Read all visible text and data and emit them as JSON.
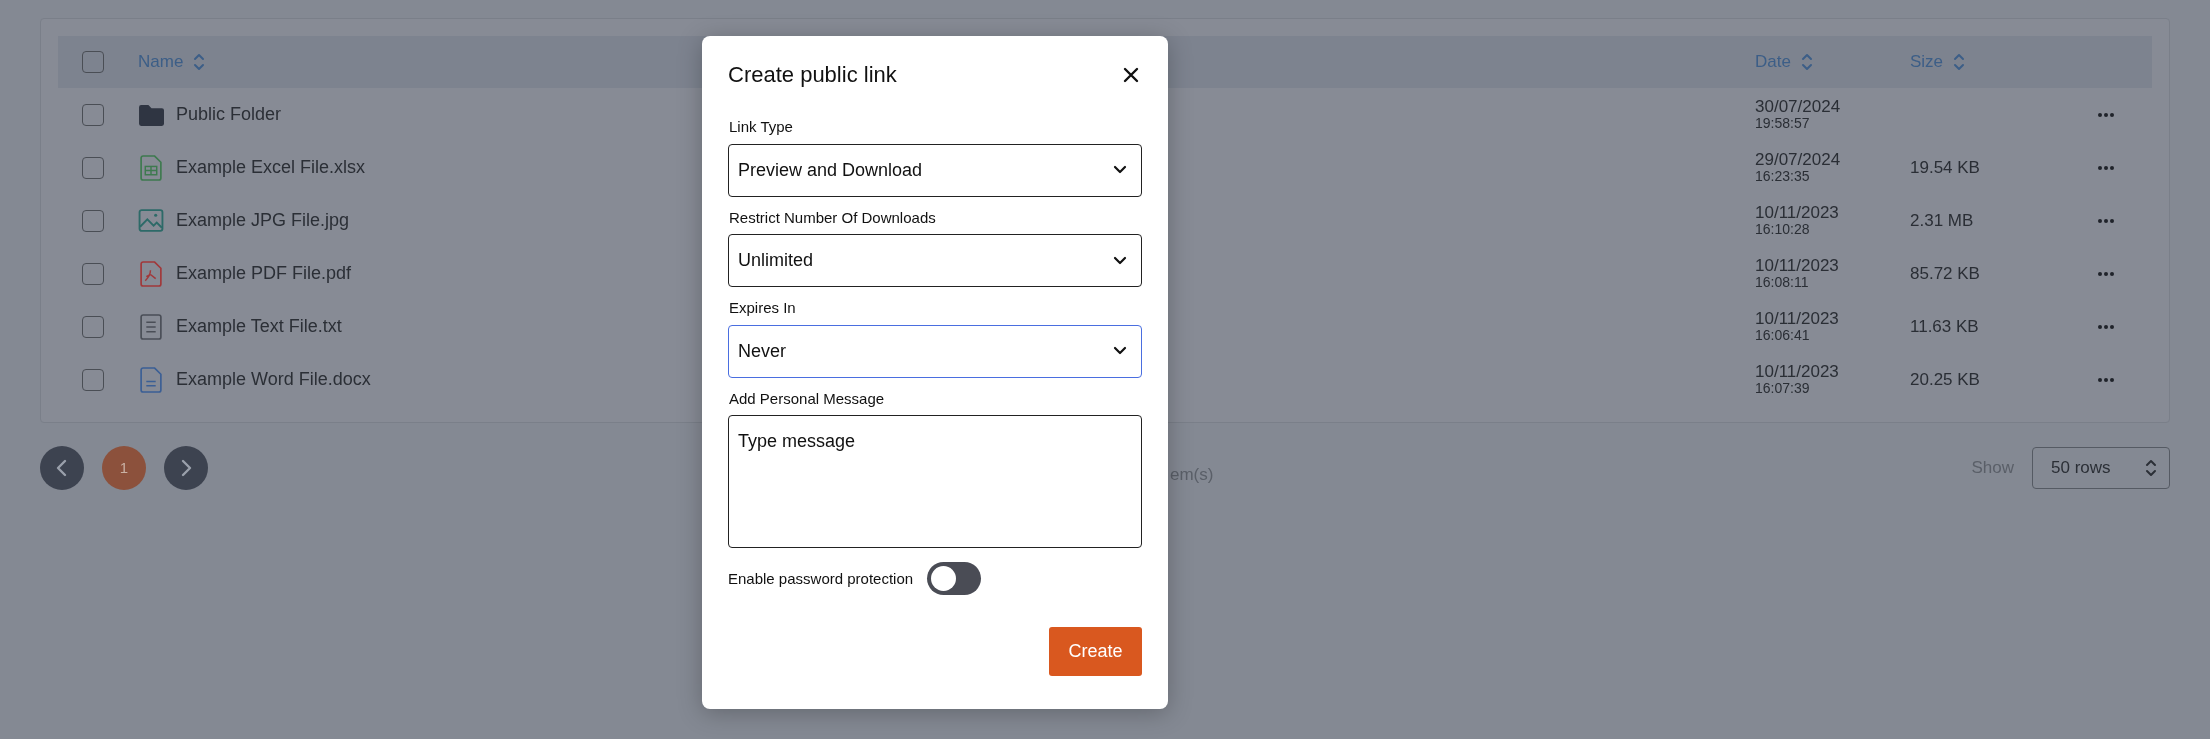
{
  "table": {
    "header_checkbox": {
      "checked": false
    },
    "columns": [
      {
        "label": "Name",
        "sortable": true
      },
      {
        "label": "Date",
        "sortable": true
      },
      {
        "label": "Size",
        "sortable": true
      }
    ],
    "rows": [
      {
        "kind": "folder",
        "name": "Public Folder",
        "date": "30/07/2024",
        "time": "19:58:57",
        "selected": false
      },
      {
        "kind": "spreadsheet",
        "name": "Example Excel File.xlsx",
        "date": "29/07/2024",
        "time": "16:23:35",
        "size": "19.54 KB",
        "selected": false
      },
      {
        "kind": "image",
        "name": "Example JPG File.jpg",
        "date": "10/11/2023",
        "time": "16:10:28",
        "size": "2.31 MB",
        "selected": false
      },
      {
        "kind": "pdf",
        "name": "Example PDF File.pdf",
        "date": "10/11/2023",
        "time": "16:08:11",
        "size": "85.72 KB",
        "selected": false
      },
      {
        "kind": "text",
        "name": "Example Text File.txt",
        "date": "10/11/2023",
        "time": "16:06:41",
        "size": "11.63 KB",
        "selected": false
      },
      {
        "kind": "document",
        "name": "Example Word File.docx",
        "date": "10/11/2023",
        "time": "16:07:39",
        "size": "20.25 KB",
        "selected": false
      }
    ]
  },
  "pagination": {
    "pages": [
      {
        "label": "1",
        "selected": true
      }
    ],
    "items_text": "em(s)",
    "show_label": "Show",
    "rows_select": "50 rows"
  },
  "modal": {
    "title": "Create public link",
    "fields": [
      {
        "kind": "select",
        "label": "Link Type",
        "value": "Preview and Download",
        "focused": false
      },
      {
        "kind": "select",
        "label": "Restrict Number Of Downloads",
        "value": "Unlimited",
        "focused": false
      },
      {
        "kind": "select",
        "label": "Expires In",
        "value": "Never",
        "focused": true
      },
      {
        "kind": "textarea",
        "label": "Add Personal Message",
        "placeholder": "Type message"
      }
    ],
    "toggle": {
      "label": "Enable password protection",
      "on": false
    },
    "button": "Create"
  }
}
